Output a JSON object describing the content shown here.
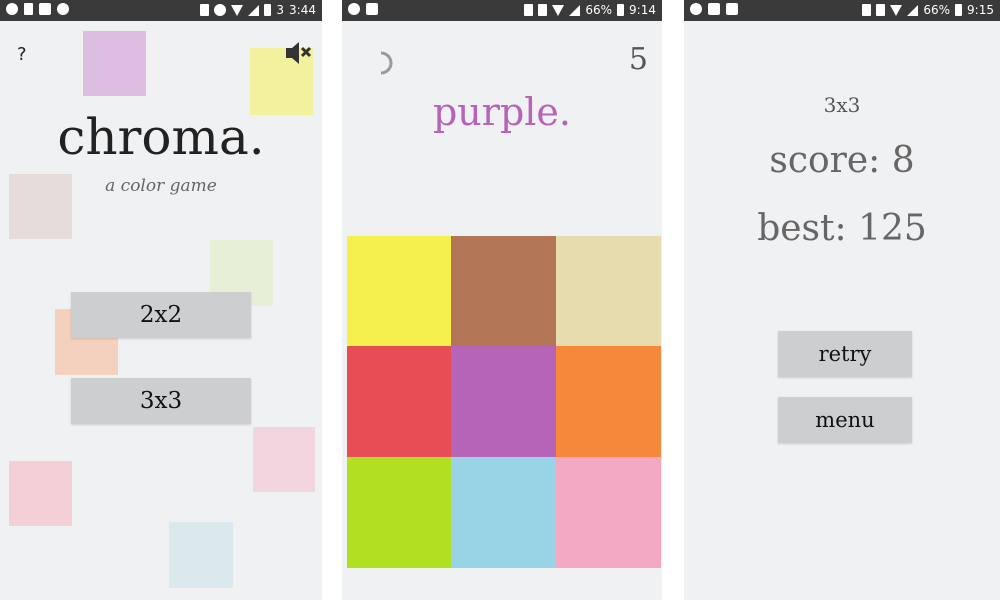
{
  "screens": {
    "menu": {
      "status": {
        "time": "3:44",
        "battery": "3"
      },
      "help_label": "?",
      "mute_icon": "speaker-muted-icon",
      "title": "chroma.",
      "tagline": "a color game",
      "buttons": [
        {
          "label": "2x2"
        },
        {
          "label": "3x3"
        }
      ],
      "background_squares": [
        "#dcbfe0",
        "#f2f19d",
        "#e5dcd9",
        "#e7efd6",
        "#f4d1bf",
        "#f1d6e0",
        "#f2d0d5",
        "#dbe9ee"
      ]
    },
    "game": {
      "status": {
        "battery": "66%",
        "time": "9:14"
      },
      "round_count": "5",
      "target_word": "purple.",
      "target_color": "#b564b8",
      "tiles": [
        {
          "name": "yellow",
          "color": "#f6f04c"
        },
        {
          "name": "brown",
          "color": "#b27556"
        },
        {
          "name": "beige",
          "color": "#e6dcae"
        },
        {
          "name": "red",
          "color": "#e64d55"
        },
        {
          "name": "purple",
          "color": "#b564b8"
        },
        {
          "name": "orange",
          "color": "#f6883c"
        },
        {
          "name": "lime",
          "color": "#b0e020"
        },
        {
          "name": "light-blue",
          "color": "#98d4e6"
        },
        {
          "name": "pink",
          "color": "#f3a8c3"
        }
      ]
    },
    "gameover": {
      "status": {
        "battery": "66%",
        "time": "9:15"
      },
      "mode": "3x3",
      "score_text": "score: 8",
      "best_text": "best: 125",
      "buttons": [
        {
          "label": "retry"
        },
        {
          "label": "menu"
        }
      ]
    }
  }
}
